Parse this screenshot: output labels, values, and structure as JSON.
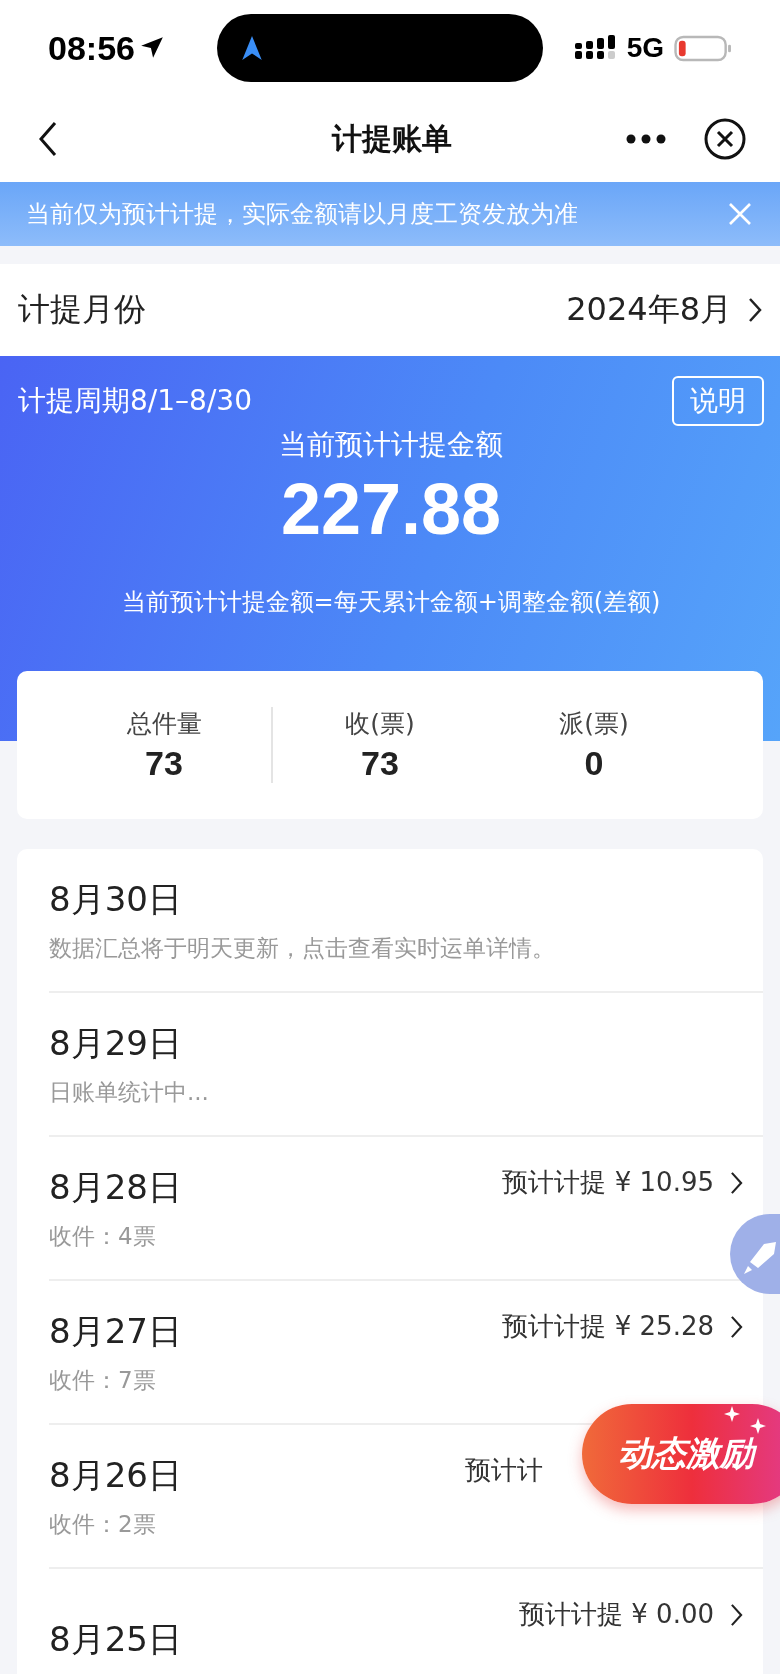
{
  "status_bar": {
    "time": "08:56",
    "network": "5G"
  },
  "nav": {
    "title": "计提账单"
  },
  "notice": {
    "text": "当前仅为预计计提，实际金额请以月度工资发放为准"
  },
  "month_row": {
    "label": "计提月份",
    "value": "2024年8月"
  },
  "summary": {
    "period": "计提周期8/1–8/30",
    "explain_button": "说明",
    "amount_label": "当前预计计提金额",
    "amount": "227.88",
    "formula": "当前预计计提金额=每天累计金额+调整金额(差额)"
  },
  "stats": [
    {
      "label": "总件量",
      "value": "73"
    },
    {
      "label": "收(票)",
      "value": "73"
    },
    {
      "label": "派(票)",
      "value": "0"
    }
  ],
  "days": [
    {
      "date": "8月30日",
      "note": "数据汇总将于明天更新，点击查看实时运单详情。"
    },
    {
      "date": "8月29日",
      "note": "日账单统计中..."
    },
    {
      "date": "8月28日",
      "note": "收件：4票",
      "estimate": "预计计提 ¥ 10.95"
    },
    {
      "date": "8月27日",
      "note": "收件：7票",
      "estimate": "预计计提 ¥ 25.28"
    },
    {
      "date": "8月26日",
      "note": "收件：2票",
      "estimate": "预计计",
      "covered": true
    },
    {
      "date": "8月25日",
      "estimate": "预计计提 ¥ 0.00"
    }
  ],
  "promo_badge": {
    "text": "动态激励"
  }
}
